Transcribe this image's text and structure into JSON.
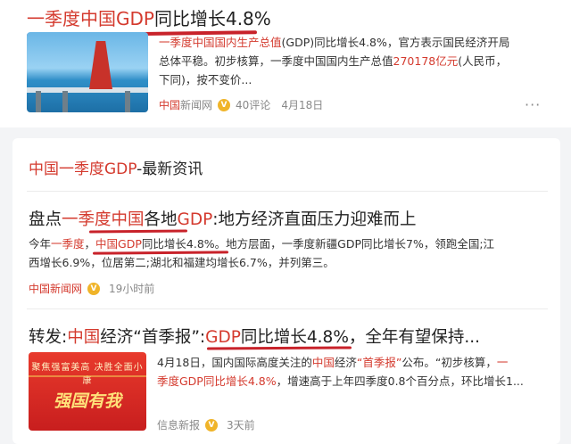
{
  "result1": {
    "title_prefix": "一季度中国GDP",
    "title_rest": "同比增长4.8%",
    "snippet_l1_a": "一季度中国国内生产总值",
    "snippet_l1_b": "(GDP)同比增长4.8%，官方表示国民经济开局",
    "snippet_l2": "总体平稳。初步核算，一季度中国国内生产总值",
    "snippet_l2_hl": "270178亿元",
    "snippet_l2_tail": "(人民币，",
    "snippet_l3": "下同)，按不变价...",
    "source": "中国",
    "source_rest": "新闻网",
    "comments": "40评论",
    "date": "4月18日",
    "more": "···"
  },
  "section": {
    "title_hl": "中国一季度GDP",
    "title_rest": "-最新资讯"
  },
  "news1": {
    "t_a": "盘点",
    "t_hl": "一季度中国",
    "t_b": "各地",
    "t_hl2": "GDP",
    "t_c": ":地方经济直面压力迎难而上",
    "l1_a": "今年",
    "l1_hl": "一季度",
    "l1_b": "，",
    "l1_hl2": "中国GDP",
    "l1_c": "同比增长4.8%。地方层面，一季度新疆GDP同比增长7%，领跑全国;江",
    "l2": "西增长6.9%，位居第二;湖北和福建均增长6.7%，并列第三。",
    "source": "中国新闻网",
    "time": "19小时前"
  },
  "news2": {
    "t_a": "转发:",
    "t_hl": "中国",
    "t_b": "经济“首季报”:",
    "t_hl2": "GDP",
    "t_c": "同比增长4.8%，全年有望保持...",
    "thumb_slogan": "聚焦强富美高 决胜全面小康",
    "thumb_big": "强国有我",
    "l1_a": "4月18日，国内国际高度关注的",
    "l1_hl": "中国",
    "l1_b": "经济",
    "l1_hl2": "“首季报”",
    "l1_c": "公布。“初步核算，",
    "l1_hl3": "一",
    "l2_hl": "季度GDP同比增长4.8%",
    "l2_rest": "，增速高于上年四季度0.8个百分点，环比增长1...",
    "source": "信息新报",
    "time": "3天前"
  }
}
